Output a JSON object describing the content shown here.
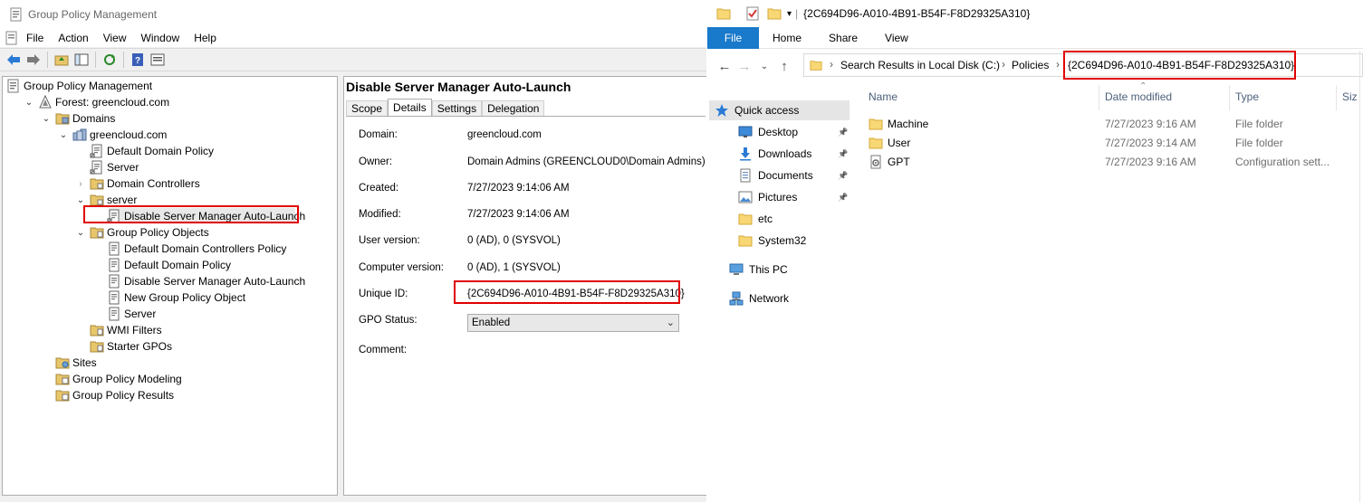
{
  "gpmc": {
    "window_title": "Group Policy Management",
    "menu": [
      "File",
      "Action",
      "View",
      "Window",
      "Help"
    ],
    "tree": [
      {
        "label": "Group Policy Management",
        "icon": "gpmc-icon",
        "depth": 0,
        "expander": ""
      },
      {
        "label": "Forest: greencloud.com",
        "icon": "forest-icon",
        "depth": 1,
        "expander": "v"
      },
      {
        "label": "Domains",
        "icon": "domains-folder-icon",
        "depth": 2,
        "expander": "v"
      },
      {
        "label": "greencloud.com",
        "icon": "domain-icon",
        "depth": 3,
        "expander": "v"
      },
      {
        "label": "Default Domain Policy",
        "icon": "gpo-link-icon",
        "depth": 4,
        "expander": ""
      },
      {
        "label": "Server",
        "icon": "gpo-link-icon",
        "depth": 4,
        "expander": ""
      },
      {
        "label": "Domain Controllers",
        "icon": "ou-folder-icon",
        "depth": 4,
        "expander": ">"
      },
      {
        "label": "server",
        "icon": "ou-folder-icon",
        "depth": 4,
        "expander": "v"
      },
      {
        "label": "Disable Server Manager Auto-Launch",
        "icon": "gpo-link-icon",
        "depth": 5,
        "expander": ""
      },
      {
        "label": "Group Policy Objects",
        "icon": "gpo-folder-icon",
        "depth": 4,
        "expander": "v"
      },
      {
        "label": "Default Domain Controllers Policy",
        "icon": "gpo-icon",
        "depth": 5,
        "expander": ""
      },
      {
        "label": "Default Domain Policy",
        "icon": "gpo-icon",
        "depth": 5,
        "expander": ""
      },
      {
        "label": "Disable Server Manager Auto-Launch",
        "icon": "gpo-icon",
        "depth": 5,
        "expander": ""
      },
      {
        "label": "New Group Policy Object",
        "icon": "gpo-icon",
        "depth": 5,
        "expander": ""
      },
      {
        "label": "Server",
        "icon": "gpo-icon",
        "depth": 5,
        "expander": ""
      },
      {
        "label": "WMI Filters",
        "icon": "wmi-folder-icon",
        "depth": 4,
        "expander": ""
      },
      {
        "label": "Starter GPOs",
        "icon": "starter-folder-icon",
        "depth": 4,
        "expander": ""
      },
      {
        "label": "Sites",
        "icon": "sites-icon",
        "depth": 2,
        "expander": ""
      },
      {
        "label": "Group Policy Modeling",
        "icon": "modeling-icon",
        "depth": 2,
        "expander": ""
      },
      {
        "label": "Group Policy Results",
        "icon": "results-icon",
        "depth": 2,
        "expander": ""
      }
    ],
    "detail": {
      "title": "Disable Server Manager Auto-Launch",
      "tabs": [
        "Scope",
        "Details",
        "Settings",
        "Delegation"
      ],
      "active_tab": "Details",
      "fields": [
        {
          "label": "Domain:",
          "value": "greencloud.com"
        },
        {
          "label": "Owner:",
          "value": "Domain Admins (GREENCLOUD0\\Domain Admins)"
        },
        {
          "label": "Created:",
          "value": "7/27/2023 9:14:06 AM"
        },
        {
          "label": "Modified:",
          "value": "7/27/2023 9:14:06 AM"
        },
        {
          "label": "User version:",
          "value": "0 (AD), 0 (SYSVOL)"
        },
        {
          "label": "Computer version:",
          "value": "0 (AD), 1 (SYSVOL)"
        },
        {
          "label": "Unique ID:",
          "value": "{2C694D96-A010-4B91-B54F-F8D29325A310}"
        },
        {
          "label": "GPO Status:",
          "value": ""
        },
        {
          "label": "Comment:",
          "value": ""
        }
      ],
      "gpo_status": "Enabled"
    }
  },
  "explorer": {
    "window_title": "{2C694D96-A010-4B91-B54F-F8D29325A310}",
    "ribbon": [
      "File",
      "Home",
      "Share",
      "View"
    ],
    "breadcrumb": [
      "Search Results in Local Disk (C:)",
      "Policies",
      "{2C694D96-A010-4B91-B54F-F8D29325A310}"
    ],
    "nav": [
      {
        "label": "Quick access",
        "icon": "star-icon",
        "pinned": false
      },
      {
        "label": "Desktop",
        "icon": "desktop-icon",
        "pinned": true
      },
      {
        "label": "Downloads",
        "icon": "download-icon",
        "pinned": true
      },
      {
        "label": "Documents",
        "icon": "documents-icon",
        "pinned": true
      },
      {
        "label": "Pictures",
        "icon": "pictures-icon",
        "pinned": true
      },
      {
        "label": "etc",
        "icon": "folder-icon",
        "pinned": false
      },
      {
        "label": "System32",
        "icon": "folder-icon",
        "pinned": false
      },
      {
        "label": "This PC",
        "icon": "pc-icon",
        "pinned": false
      },
      {
        "label": "Network",
        "icon": "network-icon",
        "pinned": false
      }
    ],
    "columns": [
      "Name",
      "Date modified",
      "Type",
      "Siz"
    ],
    "files": [
      {
        "name": "Machine",
        "date": "7/27/2023 9:16 AM",
        "type": "File folder",
        "icon": "folder-icon"
      },
      {
        "name": "User",
        "date": "7/27/2023 9:14 AM",
        "type": "File folder",
        "icon": "folder-icon"
      },
      {
        "name": "GPT",
        "date": "7/27/2023 9:16 AM",
        "type": "Configuration sett...",
        "icon": "config-file-icon"
      }
    ],
    "accent": "#1979ca",
    "highlight": "#e00000"
  }
}
